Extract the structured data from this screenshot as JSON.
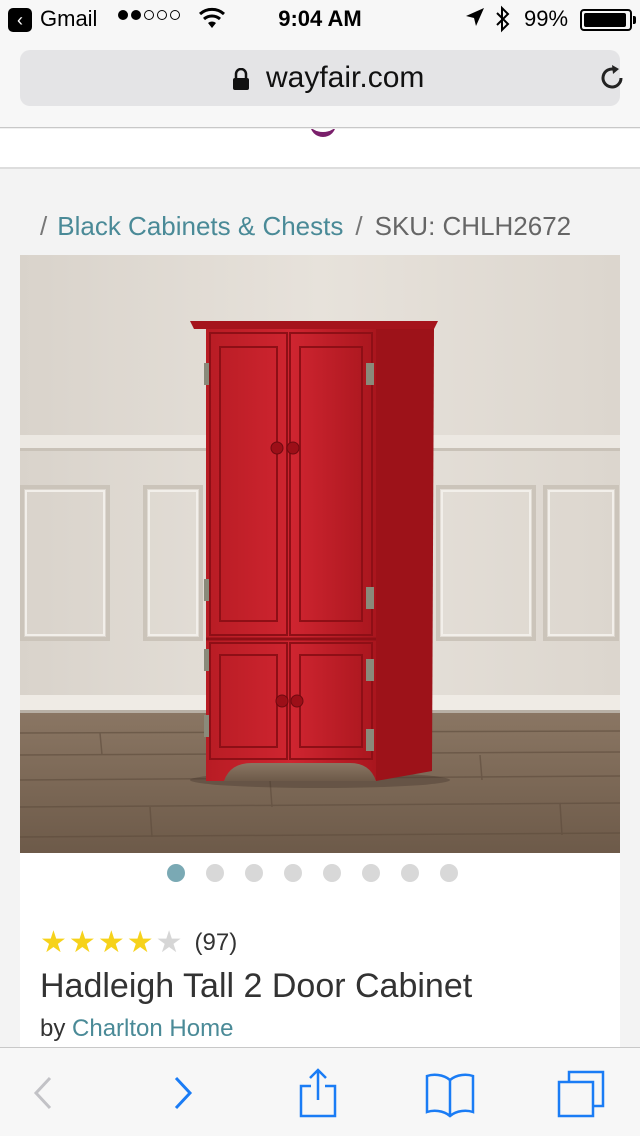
{
  "status_bar": {
    "back_app": "Gmail",
    "time": "9:04 AM",
    "battery": "99%"
  },
  "browser": {
    "url": "wayfair.com"
  },
  "breadcrumb": {
    "separator": "/",
    "category": "Black Cabinets & Chests",
    "sku": "SKU: CHLH2672"
  },
  "product": {
    "rating_stars": 4,
    "review_count": "(97)",
    "title": "Hadleigh Tall 2 Door Cabinet",
    "by_label": "by",
    "brand": "Charlton Home",
    "image_count": 8,
    "active_image": 1
  },
  "icons": {
    "back": "chevron-left-icon",
    "forward": "chevron-right-icon",
    "share": "share-icon",
    "bookmarks": "book-icon",
    "tabs": "tabs-icon"
  },
  "colors": {
    "accent_link": "#4a8a97",
    "star": "#f6d21b",
    "cabinet": "#c8202a"
  }
}
